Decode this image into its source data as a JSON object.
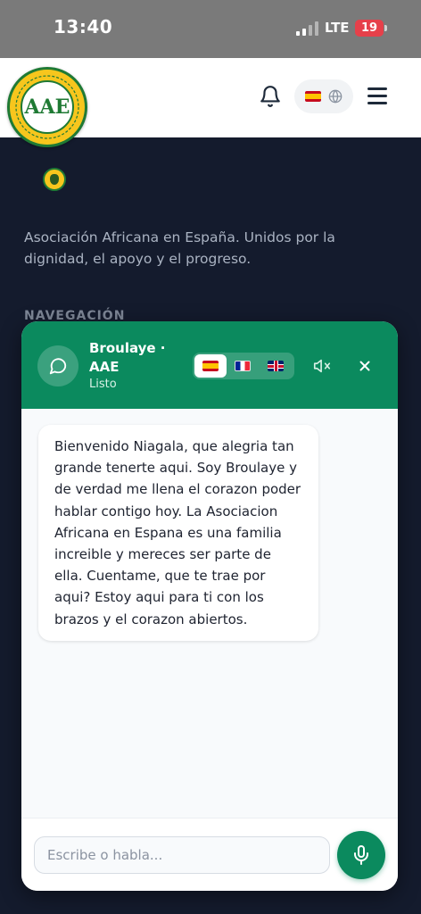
{
  "status_bar": {
    "time": "13:40",
    "network": "LTE",
    "battery": "19"
  },
  "header": {
    "logo_text": "AAE",
    "logo_ring_text": "ASOCIACIÓN AFRICANA EN ESPAÑA",
    "current_language_flag": "es-flag",
    "icons": [
      "bell-icon",
      "globe-icon",
      "hamburger-menu-icon"
    ]
  },
  "footer": {
    "description": "Asociación Africana en España. Unidos por la dignidad, el apoyo y el progreso.",
    "nav_heading": "NAVEGACIÓN"
  },
  "chat": {
    "title": "Broulaye · AAE",
    "status": "Listo",
    "languages": [
      {
        "code": "es",
        "icon": "es-flag",
        "active": true
      },
      {
        "code": "fr",
        "icon": "fr-flag",
        "active": false
      },
      {
        "code": "en",
        "icon": "gb-flag",
        "active": false
      }
    ],
    "messages": [
      {
        "from": "bot",
        "text": "Bienvenido Niagala, que alegria tan grande tenerte aqui. Soy Broulaye y de verdad me llena el corazon poder hablar contigo hoy. La Asociacion Africana en Espana es una familia increible y mereces ser parte de ella. Cuentame, que te trae por aqui? Estoy aqui para ti con los brazos y el corazon abiertos."
      }
    ],
    "input_placeholder": "Escribe o habla...",
    "accent_color": "#0b8a5e"
  }
}
